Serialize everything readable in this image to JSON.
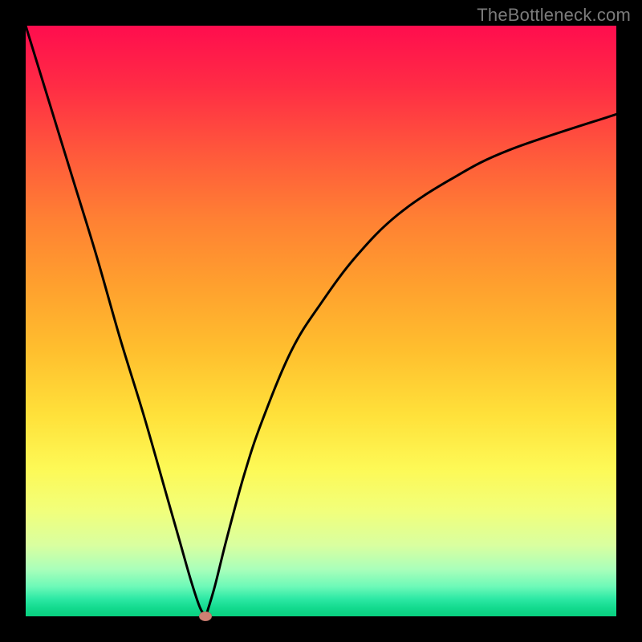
{
  "watermark": "TheBottleneck.com",
  "colors": {
    "frame": "#000000",
    "curve": "#000000",
    "marker": "#cf8073",
    "watermark": "#7b7b7b",
    "gradient_top": "#ff0d4e",
    "gradient_bottom": "#08d07f"
  },
  "chart_data": {
    "type": "line",
    "title": "",
    "xlabel": "",
    "ylabel": "",
    "xlim": [
      0,
      100
    ],
    "ylim": [
      0,
      100
    ],
    "grid": false,
    "legend": false,
    "series": [
      {
        "name": "left-branch",
        "x": [
          0,
          4,
          8,
          12,
          16,
          20,
          24,
          26,
          28,
          29.5,
          30.5
        ],
        "values": [
          100,
          87,
          74,
          61,
          47,
          34,
          20,
          13,
          6,
          1.5,
          0
        ]
      },
      {
        "name": "right-branch",
        "x": [
          30.5,
          32,
          34,
          37,
          40,
          45,
          50,
          56,
          63,
          72,
          82,
          100
        ],
        "values": [
          0,
          5,
          13,
          24,
          33,
          45,
          53,
          61,
          68,
          74,
          79,
          85
        ]
      }
    ],
    "annotations": [
      {
        "name": "minimum-marker",
        "x": 30.5,
        "y": 0
      }
    ]
  }
}
